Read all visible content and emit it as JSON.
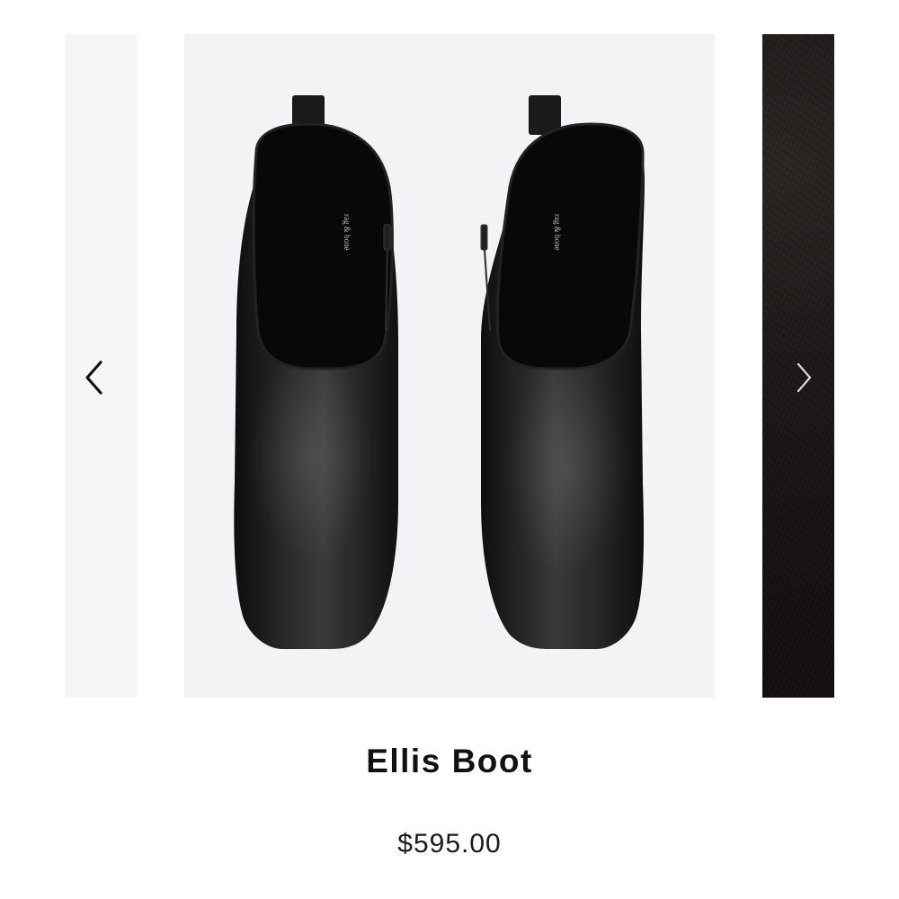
{
  "carousel": {
    "prev_label": "Previous image",
    "next_label": "Next image",
    "prev_icon": "chevron-left-icon",
    "next_icon": "chevron-right-icon",
    "main_image_alt": "Ellis Boot top view",
    "boot_logo_text": "rag & bone"
  },
  "product": {
    "title": "Ellis Boot",
    "price": "$595.00"
  },
  "colors": {
    "text": "#111111",
    "slide_background": "#f3f3f5",
    "leather": "#141414"
  }
}
